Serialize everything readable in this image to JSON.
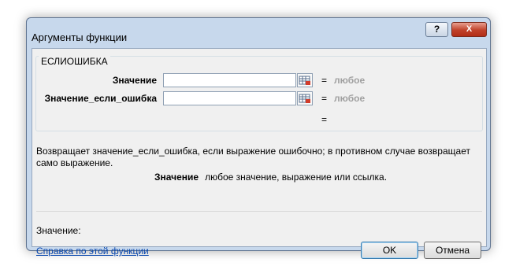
{
  "window": {
    "title": "Аргументы функции",
    "help_button": "?",
    "close_button": "X"
  },
  "function_group": {
    "name": "ЕСЛИОШИБКА",
    "args": [
      {
        "label": "Значение",
        "value": "",
        "equals": "=",
        "result_hint": "любое"
      },
      {
        "label": "Значение_если_ошибка",
        "value": "",
        "equals": "=",
        "result_hint": "любое"
      }
    ],
    "result_equals": "="
  },
  "description": "Возвращает значение_если_ошибка, если выражение ошибочно; в противном случае возвращает само выражение.",
  "param": {
    "name": "Значение",
    "text": "любое значение, выражение или ссылка."
  },
  "value_label": "Значение:",
  "help_link": "Справка по этой функции",
  "buttons": {
    "ok": "OK",
    "cancel": "Отмена"
  },
  "icons": {
    "ref_button": "range-select-icon"
  }
}
